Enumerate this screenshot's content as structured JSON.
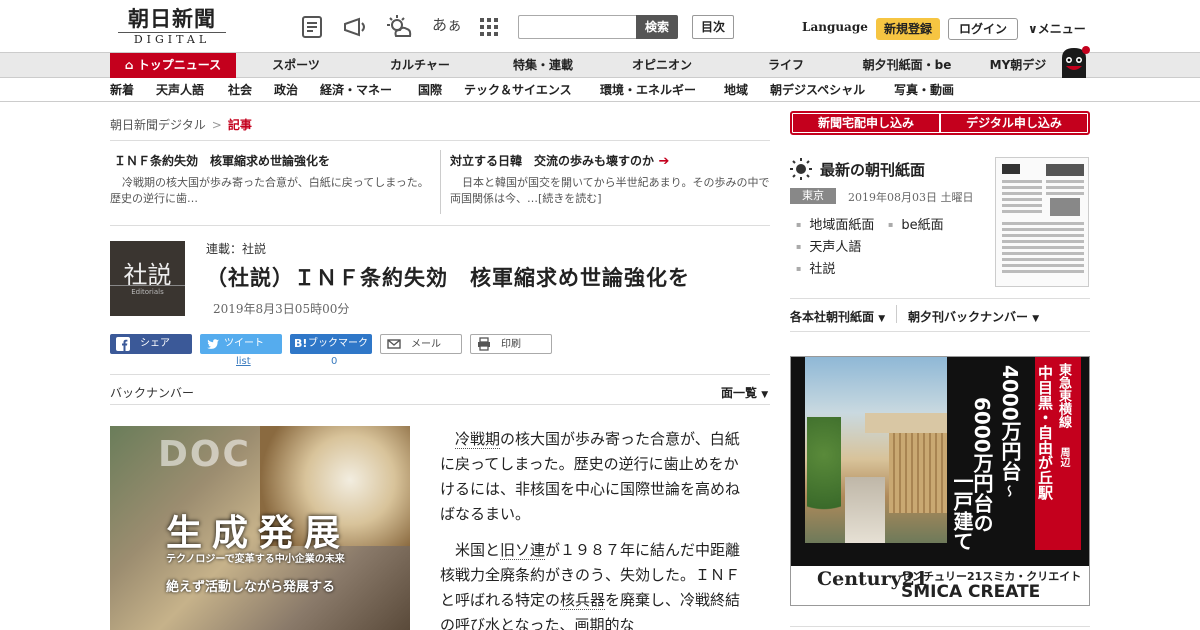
{
  "header": {
    "logo_line1": "朝日新聞",
    "logo_line2": "DIGITAL",
    "search_placeholder": "",
    "search_button": "検索",
    "mokuji": "目次",
    "language": "Language",
    "register": "新規登録",
    "login": "ログイン",
    "menu": "メニュー",
    "icons": [
      "newspaper-icon",
      "megaphone-icon",
      "weather-icon",
      "font-size-icon",
      "grid-icon"
    ],
    "font_size_label": "あぁ"
  },
  "nav1": {
    "items": [
      "トップニュース",
      "スポーツ",
      "カルチャー",
      "特集・連載",
      "オピニオン",
      "ライフ",
      "朝夕刊紙面・be",
      "MY朝デジ"
    ]
  },
  "nav2": {
    "items": [
      "新着",
      "天声人語",
      "社会",
      "政治",
      "経済・マネー",
      "国際",
      "テック＆サイエンス",
      "環境・エネルギー",
      "地域",
      "朝デジスペシャル",
      "写真・動画"
    ]
  },
  "breadcrumb": {
    "root": "朝日新聞デジタル",
    "sep": ">",
    "current": "記事"
  },
  "related": [
    {
      "title": "ＩＮＦ条約失効　核軍縮求め世論強化を",
      "desc": "冷戦期の核大国が歩み寄った合意が、白紙に戻ってしまった。歴史の逆行に歯…"
    },
    {
      "title": "対立する日韓　交流の歩みも壊すのか",
      "desc": "日本と韓国が国交を開いてから半世紀あまり。その歩みの中で両国関係は今、…[続きを読む]"
    }
  ],
  "article": {
    "thumb_kanji": "社説",
    "thumb_en": "Editorials",
    "series": "連載：社説",
    "title": "（社説）ＩＮＦ条約失効　核軍縮求め世論強化を",
    "date": "2019年8月3日05時00分",
    "back_number": "バックナンバー",
    "ichiran": "面一覧",
    "body": [
      {
        "parts": [
          "",
          "冷戦期",
          "の核大国が歩み寄った合意が、白紙に戻ってしまった。歴史の逆行に歯止めをかけるには、非核国を中心に国際世論を高めねばなるまい。"
        ]
      },
      {
        "parts": [
          "米国と",
          "旧ソ連",
          "が１９８７年に結んだ中距離核戦力全廃条約がきのう、失効した。ＩＮＦと呼ばれる特定の",
          "核兵器",
          "を廃棄し、冷戦終結の呼び水となった、画期的な"
        ]
      }
    ]
  },
  "share": {
    "buttons": [
      {
        "label": "シェア",
        "color": "#3b5998",
        "icon": "facebook-icon"
      },
      {
        "label": "ツイート",
        "color": "#55acee",
        "icon": "twitter-icon"
      },
      {
        "label": "ブックマーク",
        "color": "#2f77c8",
        "icon": "hatena-icon"
      },
      {
        "label": "メール",
        "color": "#ffffff",
        "icon": "mail-icon"
      },
      {
        "label": "印刷",
        "color": "#ffffff",
        "icon": "print-icon"
      }
    ],
    "tweet_count": "list",
    "bookmark_count": "0"
  },
  "ad_left": {
    "headline": "生成発展",
    "sub1": "テクノロジーで変革する中小企業の未来",
    "sub2": "絶えず活動しながら発展する",
    "banner": "DOC"
  },
  "sidebar": {
    "subscribe_paper": "新聞宅配申し込み",
    "subscribe_digital": "デジタル申し込み",
    "choukan_title": "最新の朝刊紙面",
    "region": "東京",
    "choukan_date": "2019年08月03日 土曜日",
    "links": [
      "地域面紙面",
      "be紙面",
      "天声人語",
      "社説"
    ],
    "dropdown1": "各本社朝刊紙面",
    "dropdown2": "朝夕刊バックナンバー"
  },
  "ad_right": {
    "line_red": "東急東横線",
    "line_red2": "中目黒・自由が丘駅",
    "line_red3": "周辺",
    "price1": "4000万円台",
    "tilde": "～",
    "price2": "6000万円台の",
    "house": "一戸建て",
    "brand": "Century21",
    "brand_jp": "センチュリー21スミカ・クリエイト",
    "brand_en": "SMICA CREATE"
  },
  "colors": {
    "accent": "#c4001d",
    "nav_bg": "#e9e9e9",
    "register": "#f6c542"
  }
}
